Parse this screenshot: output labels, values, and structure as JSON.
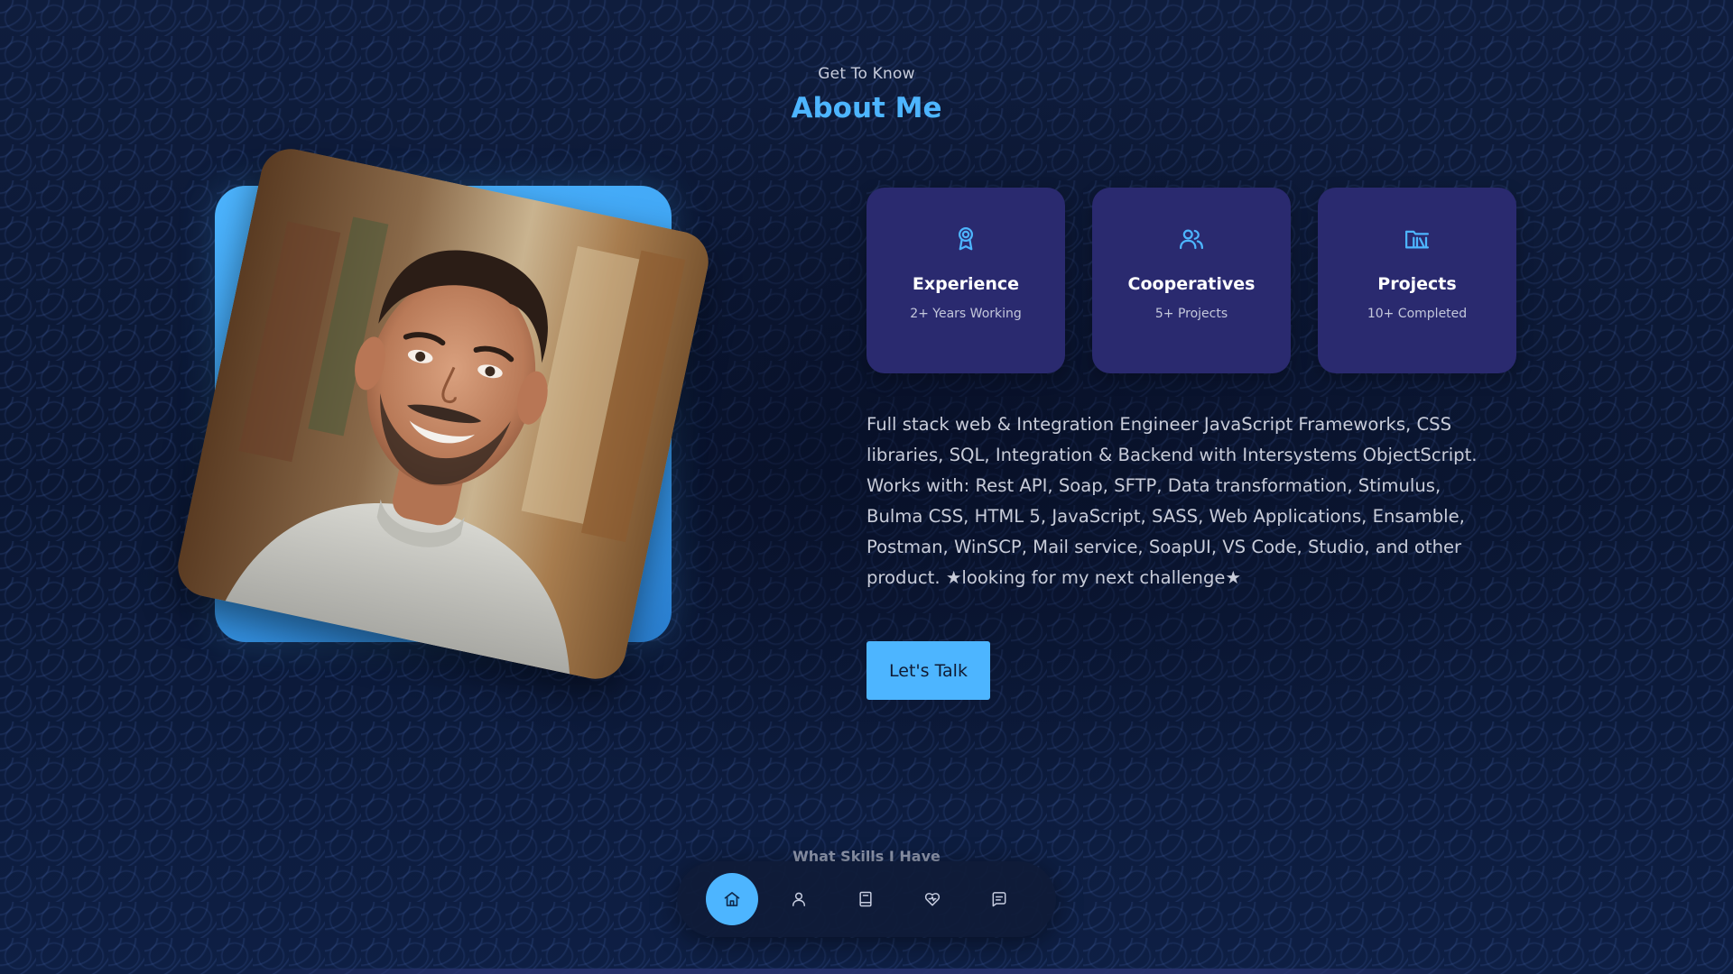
{
  "section": {
    "subtitle": "Get To Know",
    "title": "About Me"
  },
  "cards": [
    {
      "icon": "award-icon",
      "title": "Experience",
      "subtitle": "2+ Years Working"
    },
    {
      "icon": "users-icon",
      "title": "Cooperatives",
      "subtitle": "5+ Projects"
    },
    {
      "icon": "folder-library-icon",
      "title": "Projects",
      "subtitle": "10+ Completed"
    }
  ],
  "about_text": "Full stack web & Integration Engineer JavaScript Frameworks, CSS libraries, SQL, Integration & Backend with Intersystems ObjectScript. Works with: Rest API, Soap, SFTP, Data transformation, Stimulus, Bulma CSS, HTML 5, JavaScript, SASS, Web Applications, Ensamble, Postman, WinSCP, Mail service, SoapUI, VS Code, Studio, and other product. ★looking for my next challenge★",
  "cta": {
    "label": "Let's Talk"
  },
  "next_section_hint": "What Skills I Have",
  "nav": {
    "items": [
      {
        "icon": "home-icon",
        "active": true
      },
      {
        "icon": "user-icon",
        "active": false
      },
      {
        "icon": "book-icon",
        "active": false
      },
      {
        "icon": "services-icon",
        "active": false
      },
      {
        "icon": "message-icon",
        "active": false
      }
    ]
  },
  "colors": {
    "accent": "#4db5ff",
    "card_bg": "#2a2a6f",
    "background": "#0d1a36"
  }
}
